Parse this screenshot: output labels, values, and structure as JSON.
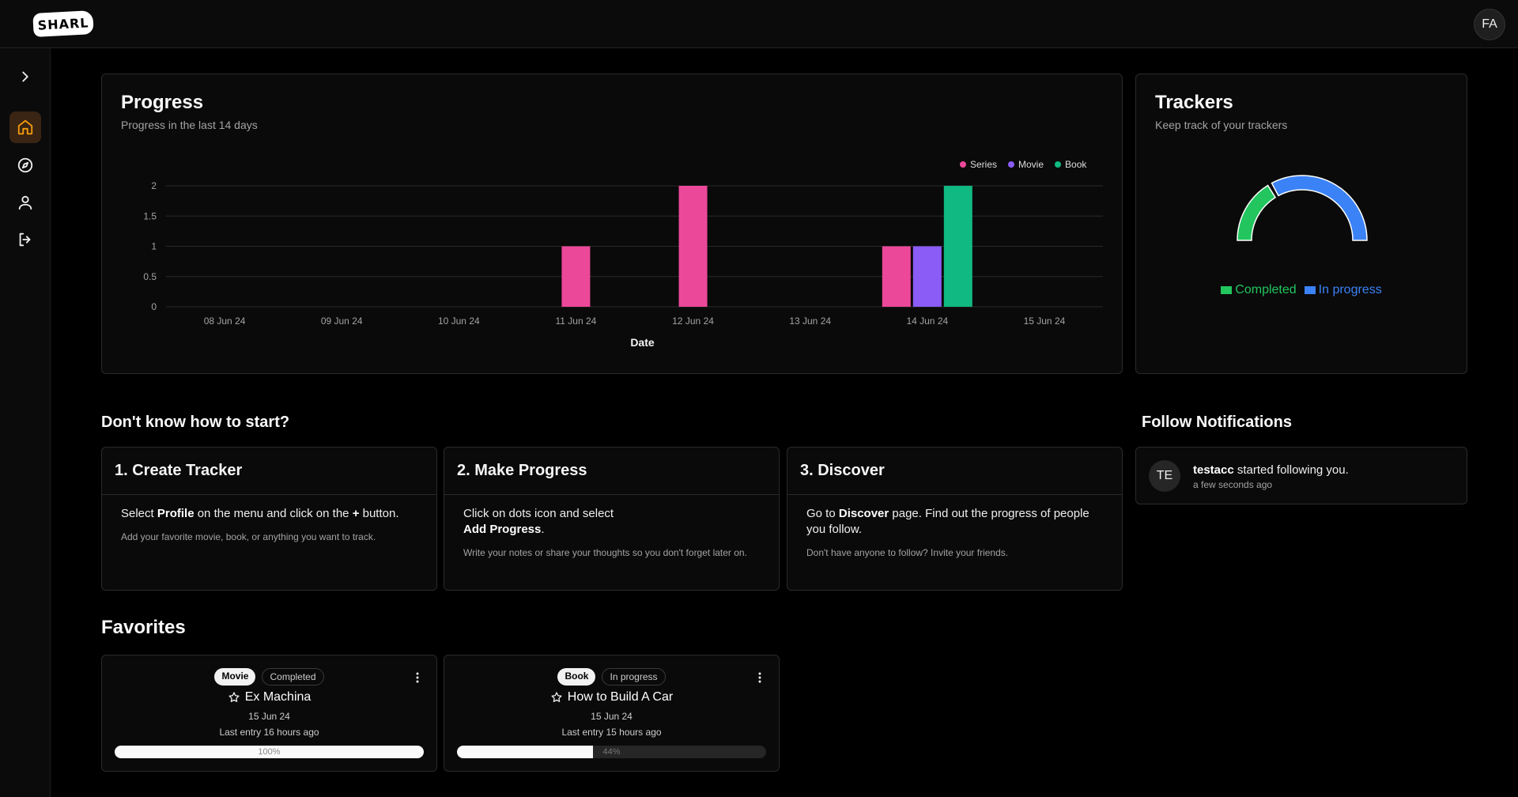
{
  "header": {
    "logo": "SHARL",
    "avatar_initials": "FA"
  },
  "progress": {
    "title": "Progress",
    "subtitle": "Progress in the last 14 days"
  },
  "chart_data": {
    "type": "bar",
    "categories": [
      "08 Jun 24",
      "09 Jun 24",
      "10 Jun 24",
      "11 Jun 24",
      "12 Jun 24",
      "13 Jun 24",
      "14 Jun 24",
      "15 Jun 24"
    ],
    "series": [
      {
        "name": "Series",
        "color": "#ec4899",
        "values": [
          0,
          0,
          0,
          1,
          2,
          0,
          1,
          0
        ]
      },
      {
        "name": "Movie",
        "color": "#8b5cf6",
        "values": [
          0,
          0,
          0,
          0,
          0,
          0,
          1,
          0
        ]
      },
      {
        "name": "Book",
        "color": "#10b981",
        "values": [
          0,
          0,
          0,
          0,
          0,
          0,
          2,
          0
        ]
      }
    ],
    "yticks": [
      "0",
      "0.5",
      "1",
      "1.5",
      "2"
    ],
    "ylim": [
      0,
      2
    ],
    "xlabel": "Date",
    "legend": "top-right",
    "grid": true
  },
  "trackers": {
    "title": "Trackers",
    "subtitle": "Keep track of your trackers",
    "chart_data": {
      "type": "pie",
      "shape": "half-donut",
      "slices": [
        {
          "name": "Completed",
          "value": 1,
          "color": "#22c55e"
        },
        {
          "name": "In progress",
          "value": 2,
          "color": "#3b82f6"
        }
      ]
    }
  },
  "start": {
    "heading": "Don't know how to start?",
    "steps": [
      {
        "title": "1. Create Tracker",
        "t1": "Select ",
        "b1": "Profile",
        "t2": " on the menu and click on the ",
        "b2": "+",
        "t3": " button.",
        "small": "Add your favorite movie, book, or anything you want to track."
      },
      {
        "title": "2. Make Progress",
        "t1": "Click on dots icon and select ",
        "b1": "Add Progress",
        "t2": ".",
        "small": "Write your notes or share your thoughts so you don't forget later on."
      },
      {
        "title": "3. Discover",
        "t1": "Go to ",
        "b1": "Discover",
        "t2": " page. Find out the progress of people you follow.",
        "small": "Don't have anyone to follow? Invite your friends."
      }
    ]
  },
  "notifications": {
    "heading": "Follow Notifications",
    "items": [
      {
        "initials": "TE",
        "user": "testacc",
        "text": " started following you.",
        "time": "a few seconds ago"
      }
    ]
  },
  "favorites": {
    "heading": "Favorites",
    "items": [
      {
        "type": "Movie",
        "status": "Completed",
        "title": "Ex Machina",
        "date": "15 Jun 24",
        "entry": "Last entry 16 hours ago",
        "progress": 100,
        "progress_label": "100%"
      },
      {
        "type": "Book",
        "status": "In progress",
        "title": "How to Build A Car",
        "date": "15 Jun 24",
        "entry": "Last entry 15 hours ago",
        "progress": 44,
        "progress_label": "44%"
      }
    ]
  }
}
